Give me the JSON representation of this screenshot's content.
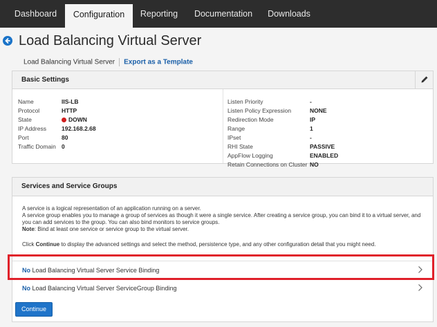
{
  "nav": {
    "tabs": [
      {
        "label": "Dashboard"
      },
      {
        "label": "Configuration"
      },
      {
        "label": "Reporting"
      },
      {
        "label": "Documentation"
      },
      {
        "label": "Downloads"
      }
    ],
    "active": "Configuration"
  },
  "page": {
    "title": "Load Balancing Virtual Server",
    "subtitle": "Load Balancing Virtual Server",
    "export_link": "Export as a Template"
  },
  "basic_settings": {
    "title": "Basic Settings",
    "left": [
      {
        "key": "Name",
        "value": "IIS-LB"
      },
      {
        "key": "Protocol",
        "value": "HTTP"
      },
      {
        "key": "State",
        "value": "DOWN"
      },
      {
        "key": "IP Address",
        "value": "192.168.2.68"
      },
      {
        "key": "Port",
        "value": "80"
      },
      {
        "key": "Traffic Domain",
        "value": "0"
      }
    ],
    "right": [
      {
        "key": "Listen Priority",
        "value": "-"
      },
      {
        "key": "Listen Policy Expression",
        "value": "NONE"
      },
      {
        "key": "Redirection Mode",
        "value": "IP"
      },
      {
        "key": "Range",
        "value": "1"
      },
      {
        "key": "IPset",
        "value": "-"
      },
      {
        "key": "RHI State",
        "value": "PASSIVE"
      },
      {
        "key": "AppFlow Logging",
        "value": "ENABLED"
      },
      {
        "key": "Retain Connections on Cluster",
        "value": "NO"
      }
    ],
    "state_color": "#d01e1e"
  },
  "services": {
    "title": "Services and Service Groups",
    "line1": "A service is a logical representation of an application running on a server.",
    "line2": "A service group enables you to manage a group of services as though it were a single service. After creating a service group, you can bind it to a virtual server, and",
    "line3": "you can add services to the group. You can also bind monitors to service groups.",
    "note_label": "Note",
    "note_text": ": Bind at least one service or service group to the virtual server.",
    "click_prefix": "Click ",
    "click_bold": "Continue",
    "click_suffix": " to display the advanced settings and select the method, persistence type, and any other configuration detail that you might need.",
    "bindings": [
      {
        "count": "No",
        "label": " Load Balancing Virtual Server Service Binding"
      },
      {
        "count": "No",
        "label": " Load Balancing Virtual Server ServiceGroup Binding"
      }
    ],
    "continue_label": "Continue"
  },
  "colors": {
    "accent": "#1f74c9",
    "highlight": "#e0202a",
    "nav_bg": "#2d2d2d"
  }
}
